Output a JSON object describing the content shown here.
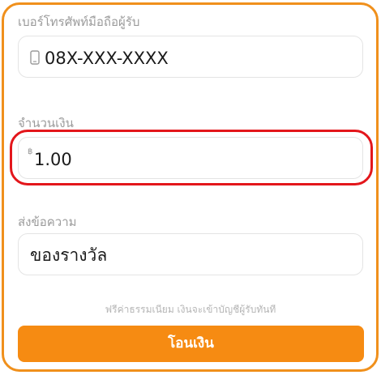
{
  "form": {
    "phone": {
      "label": "เบอร์โทรศัพท์มือถือผู้รับ",
      "icon": "phone-icon",
      "value": "08X-XXX-XXXX"
    },
    "amount": {
      "label": "จำนวนเงิน",
      "currency_symbol": "฿",
      "value": "1.00"
    },
    "message": {
      "label": "ส่งข้อความ",
      "value": "ของรางวัล"
    },
    "note": "ฟรีค่าธรรมเนียม เงินจะเข้าบัญชีผู้รับทันที",
    "submit_label": "โอนเงิน"
  },
  "colors": {
    "accent": "#f68b12",
    "card_border": "#f0901c",
    "highlight": "#e3161b"
  }
}
